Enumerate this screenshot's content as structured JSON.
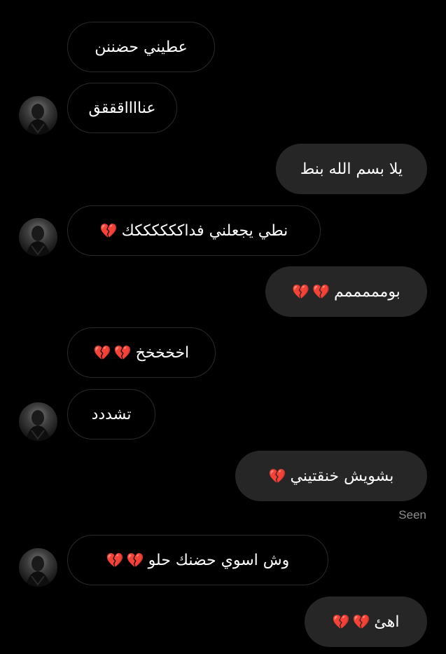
{
  "colors": {
    "background": "#000000",
    "outgoing_bubble": "#262626",
    "incoming_border": "#2a2a2a",
    "text": "#ffffff",
    "seen": "#8e8e8e",
    "heart": "#e0244a"
  },
  "messages": [
    {
      "side": "incoming",
      "text": "عطيني حضننن",
      "hearts": 0
    },
    {
      "side": "incoming",
      "text": "عنااااقققق",
      "hearts": 0
    },
    {
      "side": "outgoing",
      "text": "يلا بسم الله بنط",
      "hearts": 0
    },
    {
      "side": "incoming",
      "text": "نطي يجعلني فداككككككك",
      "hearts": 1
    },
    {
      "side": "outgoing",
      "text": "بومممممم",
      "hearts": 2
    },
    {
      "side": "incoming",
      "text": "اخخخخخ",
      "hearts": 2
    },
    {
      "side": "incoming",
      "text": "تشددد",
      "hearts": 0
    },
    {
      "side": "outgoing",
      "text": "بشويش خنقتيني",
      "hearts": 1
    },
    {
      "side": "incoming",
      "text": "وش اسوي حضنك حلو",
      "hearts": 2
    },
    {
      "side": "outgoing",
      "text": "اهئ",
      "hearts": 2
    }
  ],
  "heart_icon": "broken-heart-icon",
  "seen_label": "Seen"
}
